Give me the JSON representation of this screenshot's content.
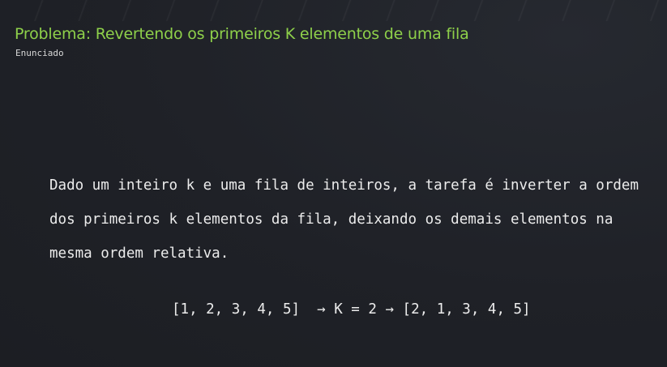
{
  "slide": {
    "title": "Problema: Revertendo os primeiros K elementos de uma fila",
    "subtitle": "Enunciado",
    "statement_lines": [
      "Dado um inteiro k e uma fila de inteiros, a tarefa é inverter a ordem",
      "dos primeiros k elementos da fila, deixando os demais elementos na",
      "mesma ordem relativa."
    ],
    "example": {
      "input": "[1, 2, 3, 4, 5]",
      "arrow1": "→",
      "param": "K = 2",
      "arrow2": "→",
      "output": "[2, 1, 3, 4, 5]"
    }
  },
  "colors": {
    "background": "#1f2127",
    "title": "#8ed04a",
    "text": "#ececec"
  }
}
